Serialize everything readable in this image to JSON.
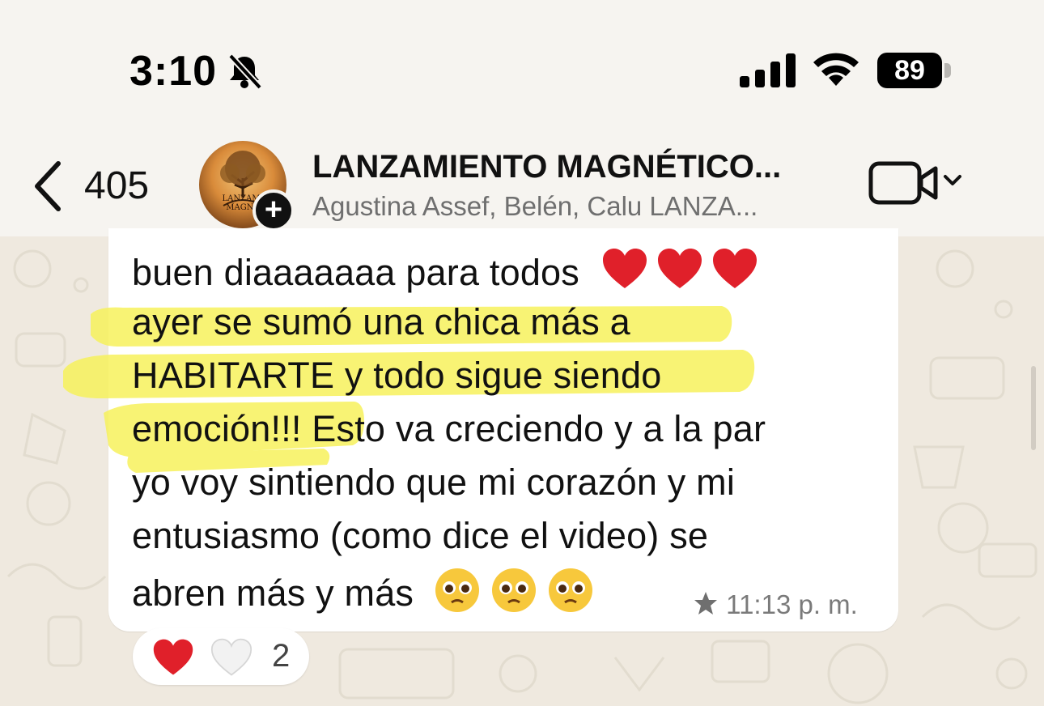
{
  "status_bar": {
    "time": "3:10",
    "battery": "89",
    "icons": [
      "bell-muted-icon",
      "cellular-signal-icon",
      "wifi-icon",
      "battery-icon"
    ]
  },
  "header": {
    "back_count": "405",
    "title": "LANZAMIENTO MAGNÉTICO...",
    "subtitle": "Agustina Assef, Belén, Calu LANZA...",
    "avatar_text_line1": "LANZAMI",
    "avatar_text_line2": "MAGNE",
    "add_badge": "+",
    "icons": [
      "chevron-left-icon",
      "video-camera-icon",
      "chevron-down-icon",
      "plus-icon"
    ]
  },
  "message": {
    "lines": [
      "buen diaaaaaaa para todos",
      "ayer se sumó una chica más a",
      "HABITARTE y todo sigue siendo",
      "emoción!!! Esto va creciendo y a la par",
      "yo voy sintiendo que mi corazón y mi",
      "entusiasmo (como dice el video) se",
      "abren más y más"
    ],
    "time": "11:13 p. m.",
    "starred": true,
    "highlight_color": "#f6f25a"
  },
  "reactions": {
    "emojis": [
      "red-heart",
      "white-heart"
    ],
    "count": "2"
  },
  "colors": {
    "background": "#efe9df",
    "bar": "#f6f4f0",
    "bubble": "#ffffff",
    "heart": "#e0202a"
  }
}
